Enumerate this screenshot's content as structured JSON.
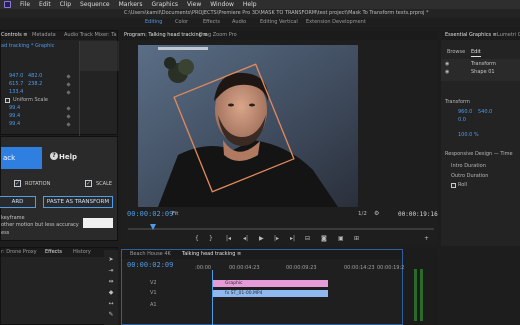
{
  "menubar": {
    "items": [
      "File",
      "Edit",
      "Clip",
      "Sequence",
      "Markers",
      "Graphics",
      "View",
      "Window",
      "Help"
    ]
  },
  "pathbar": {
    "path": "C:\\Users\\kamil\\Documents\\PROJECTS\\Premiere Pro 3D\\MASK TO TRANSFORM\\test project\\Mask To Transform tests.prproj *"
  },
  "workspaces": [
    "Editing",
    "Color",
    "Effects",
    "Audio",
    "Editing Vertical",
    "Extension Development"
  ],
  "left_panel": {
    "tabs": [
      "Controls ≡",
      "Metadata",
      "Audio Track Mixer: Ta"
    ],
    "sequence_path": "ad tracking * Graphic",
    "values": [
      {
        "a": "947.0",
        "b": "482.0"
      },
      {
        "a": "615.7",
        "b": "238.2"
      },
      {
        "a": "133.4"
      },
      {
        "label": "Uniform Scale"
      },
      {
        "a": "99.4"
      },
      {
        "a": "99.4"
      },
      {
        "a": "99.4"
      }
    ]
  },
  "plugin": {
    "track_label": "ack",
    "help_label": "Help",
    "help_icon": "?",
    "rotation_label": "ROTATION",
    "scale_label": "SCALE",
    "left_button_label": "ARD",
    "paste_button_label": "PASTE AS TRANSFORM",
    "keyframe_label": "keyframe",
    "note_text": "other motion but less accuracy",
    "option_text": "ess"
  },
  "project": {
    "tabs": [
      "r: Drone Proxy",
      "Effects",
      "History"
    ]
  },
  "program": {
    "tabs": [
      "Program: Talking head tracking ≡",
      "Drag Zoom Pro"
    ],
    "timecode_left": "00:00:02:09",
    "fit_label": "Fit",
    "resolution": "1/2",
    "timecode_right": "00:00:19:16"
  },
  "essential": {
    "title": "Essential Graphics ≡",
    "title2": "Lumetri C",
    "tabs": [
      "Browse",
      "Edit"
    ],
    "layers": [
      "Transform",
      "Shape 01"
    ],
    "transform_label": "Transform",
    "x_val": "960.0",
    "y_val": "540.0",
    "zero": "0.0",
    "percent": "100.0 %",
    "responsive_label": "Responsive Design — Time",
    "intro_label": "Intro Duration",
    "outro_label": "Outro Duration",
    "roll_label": "Roll"
  },
  "timeline": {
    "tabs": [
      "Beach House 4K",
      "Talking head tracking ≡"
    ],
    "timecode": "00:00:02:09",
    "ruler": [
      ":00:00",
      "00:00:04:23",
      "00:00:09:23",
      "00:00:14:23",
      "00:00:19:23"
    ],
    "tracks": [
      "V2",
      "V1",
      "A1"
    ],
    "clip1": "Graphic",
    "clip2": "fx  ST_01-00.MP4"
  },
  "colors": {
    "accent": "#4f9ce8",
    "graphic_clip": "#e59bd7",
    "video_clip": "#8fb8f0",
    "tracking_box": "#e28a5b"
  },
  "icons": [
    "search-icon",
    "help-icon",
    "play-icon",
    "step-back-icon",
    "step-forward-icon",
    "settings-icon",
    "camera-icon",
    "eye-icon"
  ]
}
